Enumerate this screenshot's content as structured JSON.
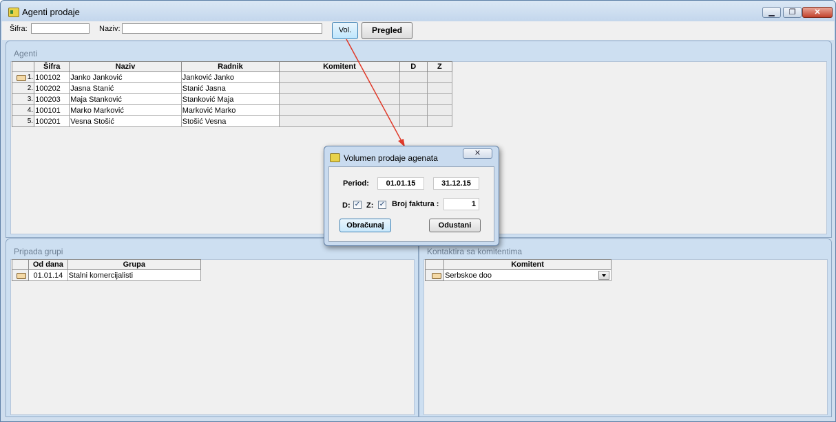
{
  "window": {
    "title": "Agenti prodaje",
    "minimize": "▁",
    "maximize": "❐",
    "close": "✕"
  },
  "toolbar": {
    "sifra_label": "Šifra:",
    "sifra_value": "",
    "naziv_label": "Naziv:",
    "naziv_value": "",
    "vol_label": "Vol.",
    "pregled_label": "Pregled"
  },
  "agenti": {
    "title": "Agenti",
    "columns": [
      "Šifra",
      "Naziv",
      "Radnik",
      "Komitent",
      "D",
      "Z"
    ],
    "rows": [
      {
        "n": "1.",
        "sifra": "100102",
        "naziv": "Janko Janković",
        "radnik": "Janković Janko",
        "komitent": "",
        "d": "",
        "z": ""
      },
      {
        "n": "2.",
        "sifra": "100202",
        "naziv": "Jasna Stanić",
        "radnik": "Stanić Jasna",
        "komitent": "",
        "d": "",
        "z": ""
      },
      {
        "n": "3.",
        "sifra": "100203",
        "naziv": "Maja Stanković",
        "radnik": "Stanković Maja",
        "komitent": "",
        "d": "",
        "z": ""
      },
      {
        "n": "4.",
        "sifra": "100101",
        "naziv": "Marko Marković",
        "radnik": "Marković Marko",
        "komitent": "",
        "d": "",
        "z": ""
      },
      {
        "n": "5.",
        "sifra": "100201",
        "naziv": "Vesna Stošić",
        "radnik": "Stošić Vesna",
        "komitent": "",
        "d": "",
        "z": ""
      }
    ]
  },
  "pripada": {
    "title": "Pripada grupi",
    "columns": [
      "Od dana",
      "Grupa"
    ],
    "rows": [
      {
        "od_dana": "01.01.14",
        "grupa": "Stalni komercijalisti"
      }
    ]
  },
  "kontaktira": {
    "title": "Kontaktira sa komitentima",
    "columns": [
      "Komitent"
    ],
    "rows": [
      {
        "komitent": "Serbskoe doo"
      }
    ]
  },
  "dialog": {
    "title": "Volumen prodaje agenata",
    "close": "✕",
    "period_label": "Period:",
    "date_from": "01.01.15",
    "date_to": "31.12.15",
    "d_label": "D:",
    "z_label": "Z:",
    "d_checked": true,
    "z_checked": true,
    "check_mark": "✓",
    "broj_faktura_label": "Broj faktura :",
    "broj_faktura_value": "1",
    "obracunaj_label": "Obračunaj",
    "odustani_label": "Odustani"
  },
  "colors": {
    "annotation_arrow": "#e03a2a",
    "accent": "#3c7fb1"
  }
}
